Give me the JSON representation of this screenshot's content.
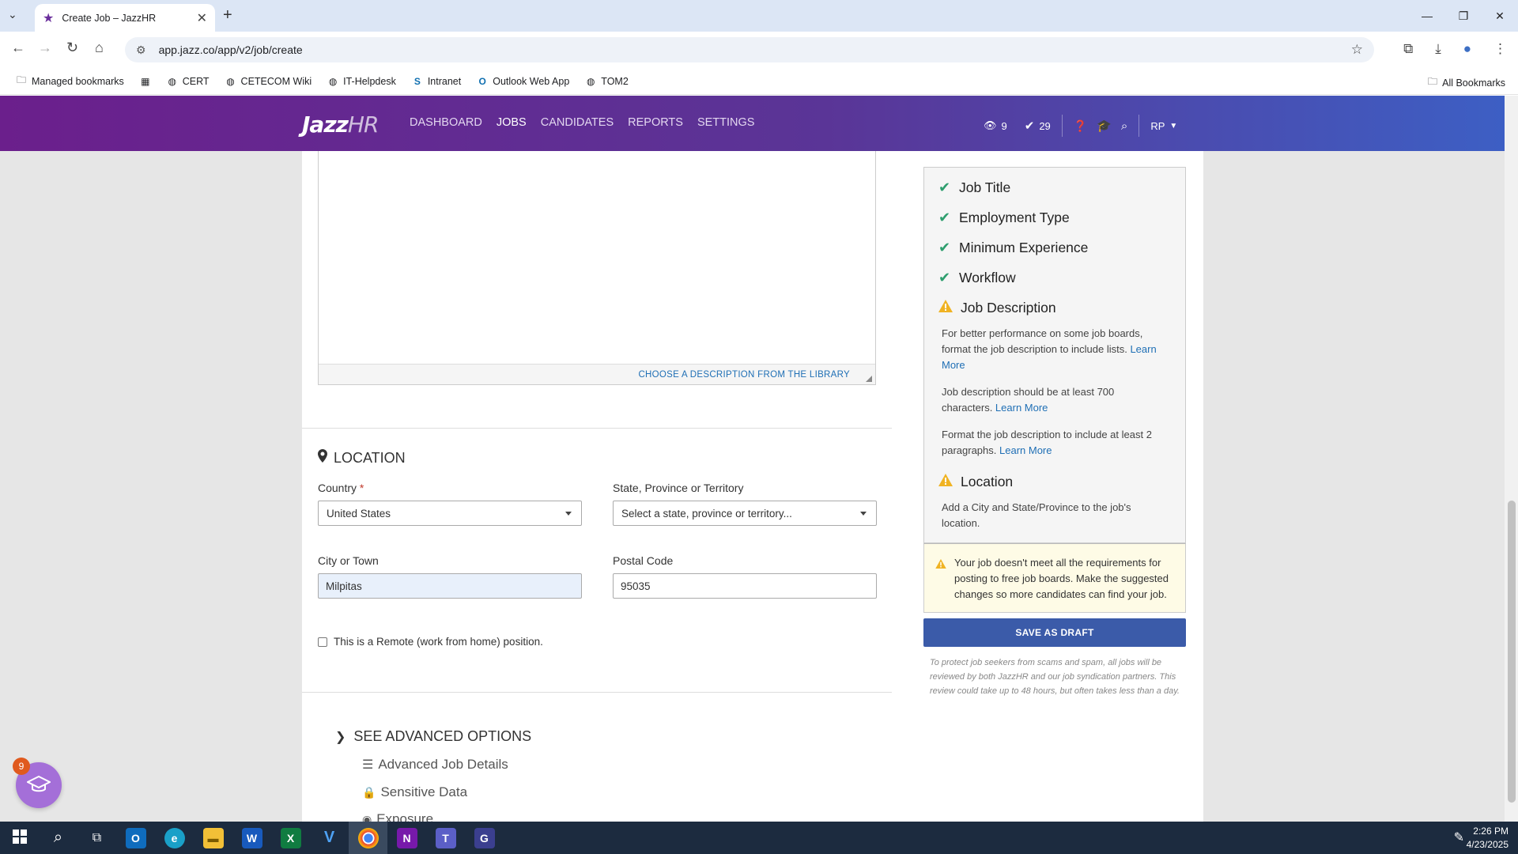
{
  "browser": {
    "tab_title": "Create Job – JazzHR",
    "url": "app.jazz.co/app/v2/job/create",
    "bookmarks": [
      "Managed bookmarks",
      "CERT",
      "CETECOM Wiki",
      "IT-Helpdesk",
      "Intranet",
      "Outlook Web App",
      "TOM2"
    ],
    "all_bookmarks": "All Bookmarks"
  },
  "nav": {
    "logo_main": "Jazz",
    "logo_sub": "HR",
    "links": [
      "DASHBOARD",
      "JOBS",
      "CANDIDATES",
      "REPORTS",
      "SETTINGS"
    ],
    "active": "JOBS",
    "views_count": "9",
    "checks_count": "29",
    "user_initials": "RP"
  },
  "editor": {
    "library_link": "CHOOSE A DESCRIPTION FROM THE LIBRARY"
  },
  "location": {
    "title": "LOCATION",
    "country_label": "Country",
    "country_required": "*",
    "country_value": "United States",
    "state_label": "State, Province or Territory",
    "state_placeholder": "Select a state, province or territory...",
    "city_label": "City or Town",
    "city_value": "Milpitas",
    "postal_label": "Postal Code",
    "postal_value": "95035",
    "remote_label": "This is a Remote (work from home) position."
  },
  "advanced": {
    "title": "SEE ADVANCED OPTIONS",
    "items": [
      "Advanced Job Details",
      "Sensitive Data",
      "Exposure"
    ]
  },
  "checklist": {
    "items": [
      {
        "label": "Job Title",
        "status": "ok"
      },
      {
        "label": "Employment Type",
        "status": "ok"
      },
      {
        "label": "Minimum Experience",
        "status": "ok"
      },
      {
        "label": "Workflow",
        "status": "ok"
      }
    ],
    "job_description": {
      "label": "Job Description",
      "notes": [
        {
          "text": "For better performance on some job boards, format the job description to include lists. ",
          "link": "Learn More"
        },
        {
          "text": "Job description should be at least 700 characters. ",
          "link": "Learn More"
        },
        {
          "text": "Format the job description to include at least 2 paragraphs. ",
          "link": "Learn More"
        }
      ]
    },
    "location": {
      "label": "Location",
      "note": "Add a City and State/Province to the job's location."
    }
  },
  "notice": "Your job doesn't meet all the requirements for posting to free job boards. Make the suggested changes so more candidates can find your job.",
  "save_button": "SAVE AS DRAFT",
  "fine_print": "To protect job seekers from scams and spam, all jobs will be reviewed by both JazzHR and our job syndication partners. This review could take up to 48 hours, but often takes less than a day.",
  "academy_badge": "9",
  "taskbar": {
    "time": "2:26 PM",
    "date": "4/23/2025"
  },
  "colors": {
    "brand_purple": "#6b1f8c",
    "brand_blue": "#3d5fc4",
    "ok_green": "#2e9e6e",
    "warn_yellow": "#f0b323",
    "link_blue": "#1f6fb5",
    "save_button": "#3b5ba9"
  }
}
